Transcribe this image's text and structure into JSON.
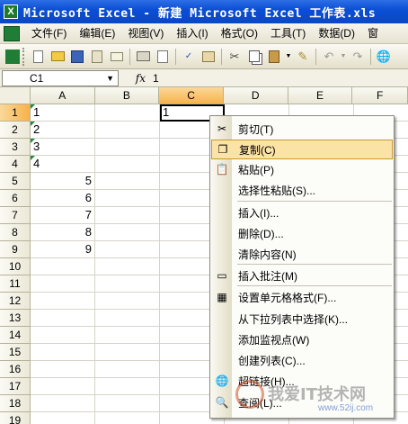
{
  "window": {
    "title": "Microsoft Excel - 新建 Microsoft Excel 工作表.xls"
  },
  "menubar": {
    "items": [
      "文件(F)",
      "编辑(E)",
      "视图(V)",
      "插入(I)",
      "格式(O)",
      "工具(T)",
      "数据(D)",
      "窗"
    ]
  },
  "toolbar": {
    "icons": [
      "app-icon",
      "new-icon",
      "open-icon",
      "save-icon",
      "permission-icon",
      "email-icon",
      "print-icon",
      "preview-icon",
      "spelling-icon",
      "research-icon",
      "cut-icon",
      "copy-icon",
      "paste-icon",
      "format-painter-icon",
      "undo-icon",
      "redo-icon",
      "hyperlink-icon"
    ]
  },
  "formula": {
    "name_box": "C1",
    "fx": "fx",
    "value": "1"
  },
  "sheet": {
    "columns": [
      "A",
      "B",
      "C",
      "D",
      "E",
      "F"
    ],
    "active_column": "C",
    "rows": [
      {
        "num": "1",
        "A": "1",
        "B": "",
        "C": "1"
      },
      {
        "num": "2",
        "A": "2",
        "B": "",
        "C": ""
      },
      {
        "num": "3",
        "A": "3",
        "B": "",
        "C": ""
      },
      {
        "num": "4",
        "A": "4",
        "B": "",
        "C": ""
      },
      {
        "num": "5",
        "A": "5",
        "B": "",
        "C": ""
      },
      {
        "num": "6",
        "A": "6",
        "B": "",
        "C": ""
      },
      {
        "num": "7",
        "A": "7",
        "B": "",
        "C": ""
      },
      {
        "num": "8",
        "A": "8",
        "B": "",
        "C": ""
      },
      {
        "num": "9",
        "A": "9",
        "B": "",
        "C": ""
      },
      {
        "num": "10",
        "A": "",
        "B": "",
        "C": ""
      },
      {
        "num": "11",
        "A": "",
        "B": "",
        "C": ""
      },
      {
        "num": "12",
        "A": "",
        "B": "",
        "C": ""
      },
      {
        "num": "13",
        "A": "",
        "B": "",
        "C": ""
      },
      {
        "num": "14",
        "A": "",
        "B": "",
        "C": ""
      },
      {
        "num": "15",
        "A": "",
        "B": "",
        "C": ""
      },
      {
        "num": "16",
        "A": "",
        "B": "",
        "C": ""
      },
      {
        "num": "17",
        "A": "",
        "B": "",
        "C": ""
      },
      {
        "num": "18",
        "A": "",
        "B": "",
        "C": ""
      },
      {
        "num": "19",
        "A": "",
        "B": "",
        "C": ""
      }
    ]
  },
  "context_menu": {
    "items": [
      {
        "label": "剪切(T)",
        "icon": "scissors-icon"
      },
      {
        "label": "复制(C)",
        "icon": "copy-icon",
        "highlighted": true
      },
      {
        "label": "粘贴(P)",
        "icon": "paste-icon"
      },
      {
        "label": "选择性粘贴(S)...",
        "icon": ""
      },
      {
        "label": "插入(I)...",
        "icon": ""
      },
      {
        "label": "删除(D)...",
        "icon": ""
      },
      {
        "label": "清除内容(N)",
        "icon": ""
      },
      {
        "label": "插入批注(M)",
        "icon": "comment-icon"
      },
      {
        "label": "设置单元格格式(F)...",
        "icon": "format-cells-icon"
      },
      {
        "label": "从下拉列表中选择(K)...",
        "icon": ""
      },
      {
        "label": "添加监视点(W)",
        "icon": ""
      },
      {
        "label": "创建列表(C)...",
        "icon": ""
      },
      {
        "label": "超链接(H)...",
        "icon": "hyperlink-icon"
      },
      {
        "label": "查阅(L)...",
        "icon": "research-icon"
      }
    ]
  },
  "watermark": {
    "text": "我爱IT技术网",
    "url": "www.52ij.com"
  }
}
